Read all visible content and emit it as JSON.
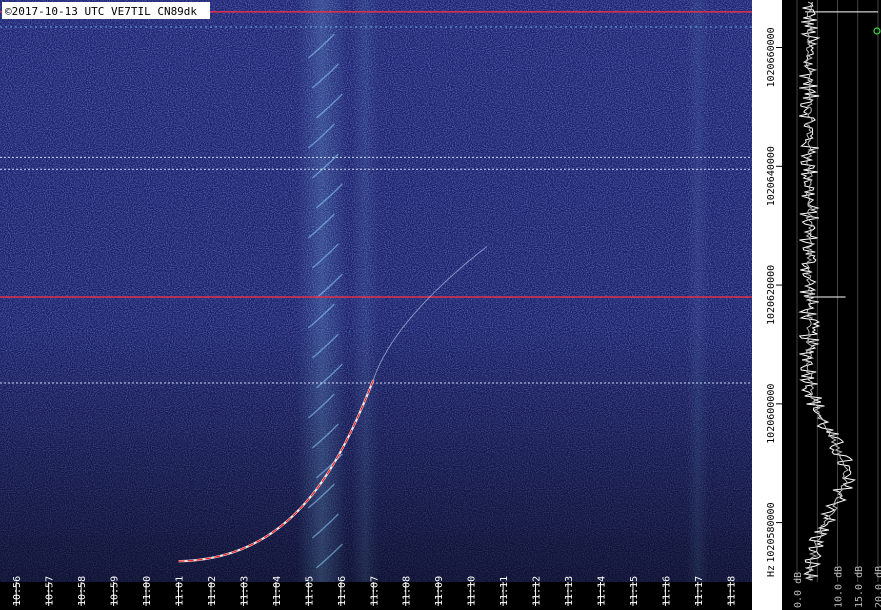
{
  "header": {
    "caption": "©2017-10-13 UTC VE7TIL CN89dk"
  },
  "colors": {
    "background": "#0d1140",
    "waterfall_base": "#1c2370",
    "waterfall_dark": "#0a0c28",
    "marker_line": "#e0304a",
    "meteor_trace": "#ffffff",
    "meteor_core": "#ff2020",
    "streak_color": "#8fd6ff",
    "spectrum_line": "#ffffff",
    "spectrum_bg": "#000000",
    "grid": "#555555",
    "label_bg": "#ffffff",
    "label_text": "#000000"
  },
  "chart_data": {
    "type": "heatmap",
    "title": "",
    "xlabel": "",
    "ylabel": "Hz",
    "x_ticks": [
      "10:56",
      "10:57",
      "10:58",
      "10:59",
      "11:00",
      "11:01",
      "11:02",
      "11:03",
      "11:04",
      "11:05",
      "11:06",
      "11:07",
      "11:08",
      "11:09",
      "11:10",
      "11:11",
      "11:12",
      "11:13",
      "11:14",
      "11:15",
      "11:16",
      "11:17",
      "11:18",
      "11:19"
    ],
    "y_ticks": [
      "1020660000",
      "1020640000",
      "1020620000",
      "1020600000",
      "1020580000"
    ],
    "y_unit": "Hz",
    "ylim": [
      1020570000,
      1020668000
    ],
    "xlim": [
      "10:55:30",
      "11:19:30"
    ],
    "horizontal_markers_hz": [
      1020666000,
      1020618000
    ],
    "carrier_lines_hz": [
      1020641500,
      1020639500,
      1020603500
    ],
    "meteor_trace": {
      "start_time": "11:01:00",
      "end_time": "11:07:00",
      "start_hz": 1020573500,
      "end_hz": 1020604000,
      "faint_extension_end_time": "11:10:30",
      "faint_extension_end_hz": 1020626500
    },
    "spectrum_panel": {
      "scale_labels": [
        "0.0 dB",
        "10.0 dB",
        "15.0 dB",
        "20.0 dB"
      ],
      "scale_values_db": [
        0,
        10,
        15,
        20
      ]
    }
  }
}
